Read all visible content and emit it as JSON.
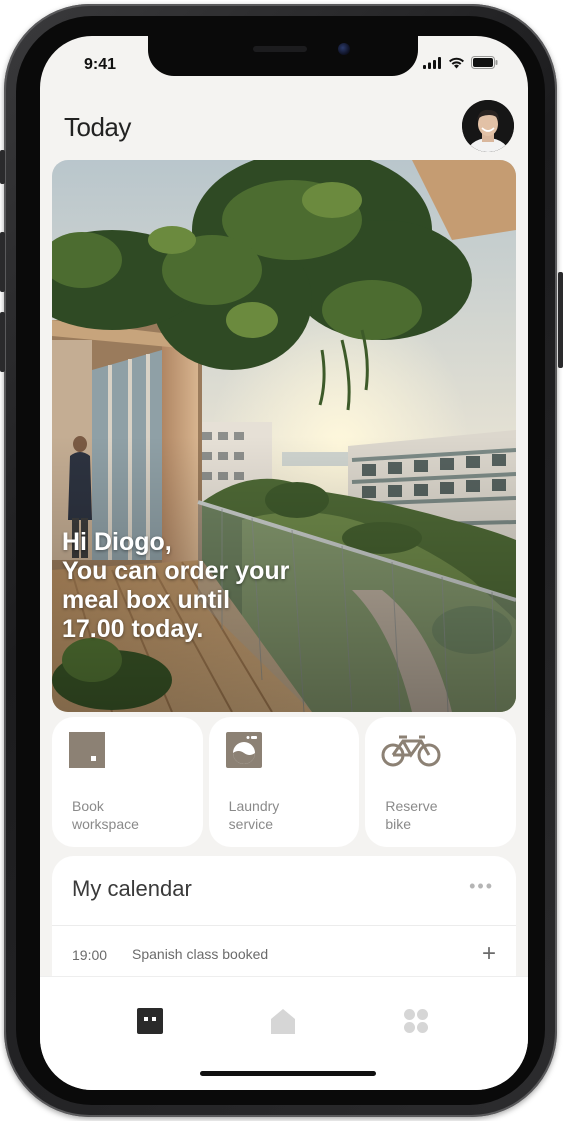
{
  "status_bar": {
    "time": "9:41"
  },
  "header": {
    "title": "Today"
  },
  "hero": {
    "message_lines": [
      "Hi Diogo,",
      "You can order your",
      "meal box until",
      "17.00 today."
    ]
  },
  "quick_actions": [
    {
      "icon": "workspace-icon",
      "label_line1": "Book",
      "label_line2": "workspace"
    },
    {
      "icon": "washing-machine-icon",
      "label_line1": "Laundry",
      "label_line2": "service"
    },
    {
      "icon": "bicycle-icon",
      "label_line1": "Reserve",
      "label_line2": "bike"
    }
  ],
  "calendar": {
    "title": "My calendar",
    "more_label": "•••",
    "events": [
      {
        "time": "19:00",
        "title": "Spanish class booked",
        "action": "+"
      }
    ]
  },
  "tab_bar": {
    "tabs": [
      {
        "icon": "today-icon",
        "active": true
      },
      {
        "icon": "home-icon",
        "active": false
      },
      {
        "icon": "apps-grid-icon",
        "active": false
      }
    ]
  },
  "colors": {
    "accent_taupe": "#8c8174",
    "screen_background": "#f4f3f1",
    "card_background": "#ffffff",
    "active_tab": "#2a2a2a",
    "inactive_tab": "#d6d6d6"
  }
}
